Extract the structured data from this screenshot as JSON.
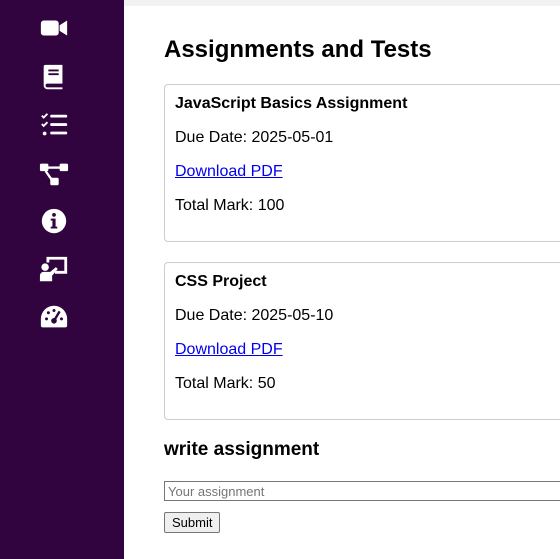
{
  "sidebar": {
    "items": [
      {
        "icon": "video-camera-icon"
      },
      {
        "icon": "book-icon"
      },
      {
        "icon": "task-list-icon"
      },
      {
        "icon": "network-icon"
      },
      {
        "icon": "info-icon"
      },
      {
        "icon": "presentation-icon"
      },
      {
        "icon": "gauge-icon"
      }
    ],
    "background": "#31043f"
  },
  "main": {
    "title": "Assignments and Tests",
    "assignments": [
      {
        "title": "JavaScript Basics Assignment",
        "due": "Due Date: 2025-05-01",
        "download": "Download PDF",
        "mark": "Total Mark: 100"
      },
      {
        "title": "CSS Project",
        "due": "Due Date: 2025-05-10",
        "download": "Download PDF",
        "mark": "Total Mark: 50"
      }
    ],
    "write": {
      "heading": "write assignment",
      "placeholder": "Your assignment",
      "submit_label": "Submit"
    }
  }
}
